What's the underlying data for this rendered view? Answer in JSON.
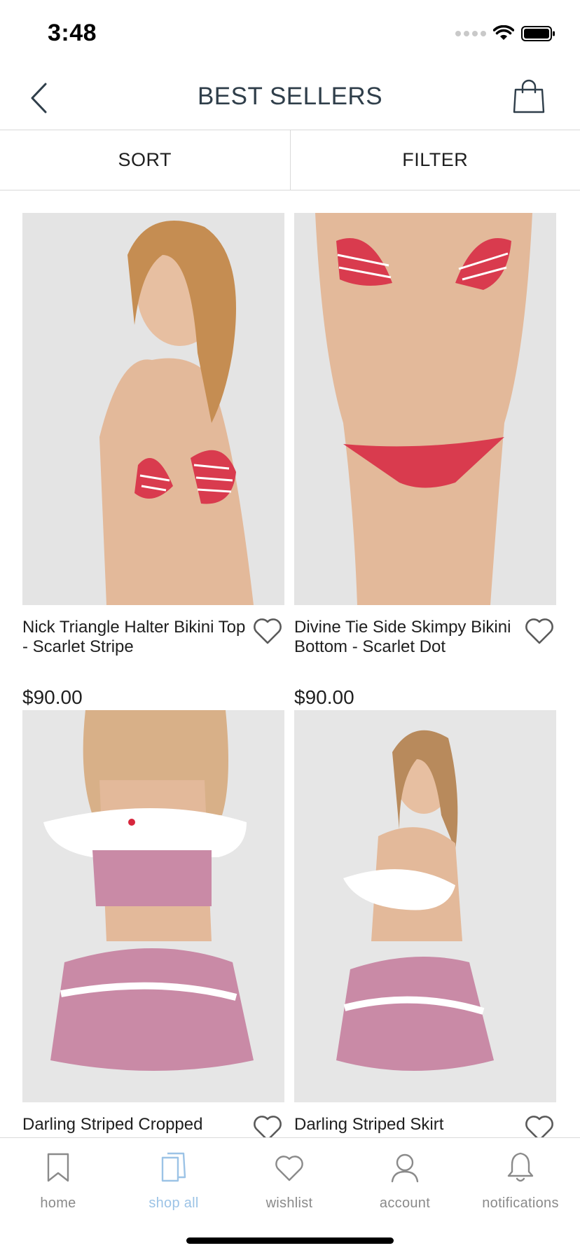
{
  "status": {
    "time": "3:48"
  },
  "header": {
    "title": "BEST SELLERS"
  },
  "sortbar": {
    "sort_label": "SORT",
    "filter_label": "FILTER"
  },
  "products": [
    {
      "name": "Nick Triangle Halter Bikini Top - Scarlet Stripe",
      "price": "$90.00",
      "image": "model-striped-bikini-top"
    },
    {
      "name": "Divine Tie Side Skimpy Bikini Bottom - Scarlet Dot",
      "price": "$90.00",
      "image": "model-red-dot-bikini-bottom"
    },
    {
      "name": "Darling Striped Cropped",
      "price": "",
      "image": "model-pink-off-shoulder-top-skirt"
    },
    {
      "name": "Darling Striped Skirt",
      "price": "",
      "image": "model-pink-striped-skirt"
    }
  ],
  "tabs": [
    {
      "label": "home",
      "icon": "bookmark-icon"
    },
    {
      "label": "shop all",
      "icon": "shopping-bag-icon"
    },
    {
      "label": "wishlist",
      "icon": "heart-icon"
    },
    {
      "label": "account",
      "icon": "person-icon"
    },
    {
      "label": "notifications",
      "icon": "bell-icon"
    }
  ],
  "colors": {
    "title": "#2f3e4a",
    "active_tab": "#9cc3e6",
    "inactive_tab": "#8a8a8a",
    "divider": "#d9d9d9",
    "accent_red": "#d7263d"
  }
}
